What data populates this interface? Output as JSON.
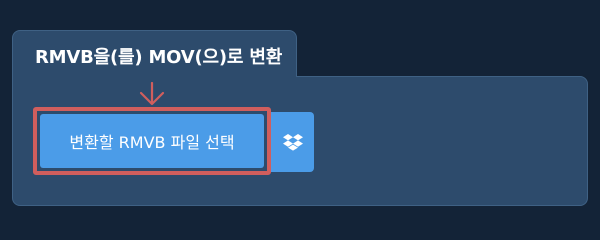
{
  "panel": {
    "tab_title": "RMVB을(를) MOV(으)로 변환"
  },
  "upload": {
    "select_button_label": "변환할 RMVB 파일 선택",
    "dropbox_icon": "dropbox-icon"
  },
  "colors": {
    "page_background": "#132337",
    "panel_background": "#2d4b6c",
    "button_blue": "#4b9ce8",
    "highlight_red": "#d05e5d"
  }
}
